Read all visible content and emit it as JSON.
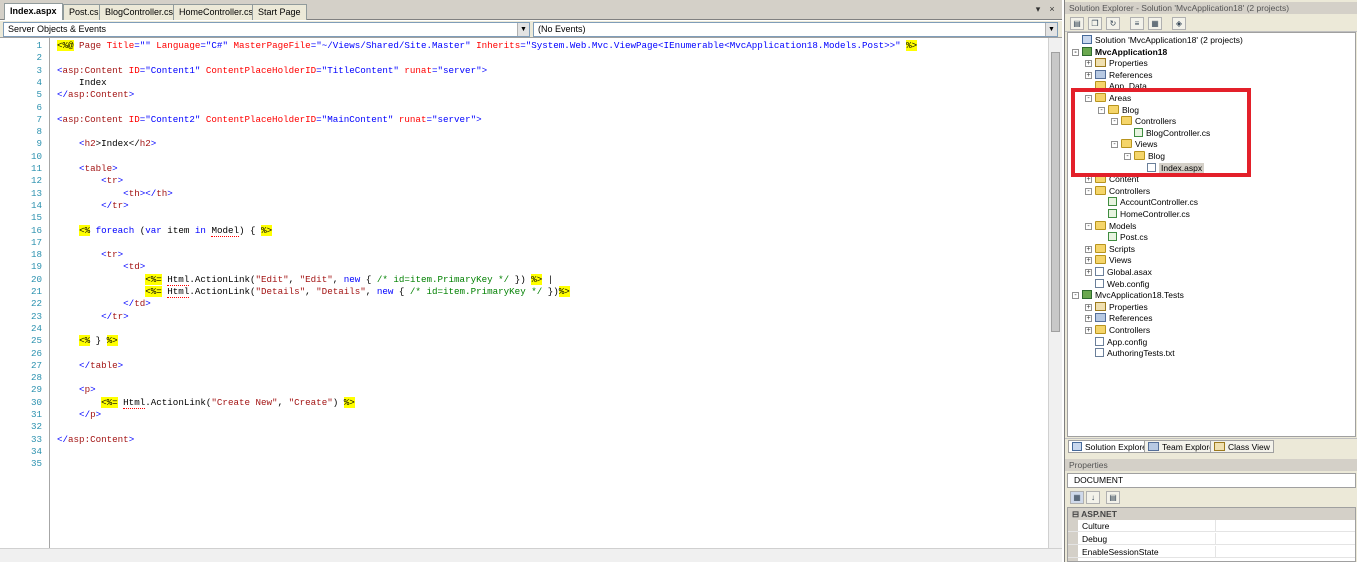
{
  "editor": {
    "tabs": [
      {
        "label": "Index.aspx",
        "active": true
      },
      {
        "label": "Post.cs",
        "active": false
      },
      {
        "label": "BlogController.cs",
        "active": false
      },
      {
        "label": "HomeController.cs",
        "active": false
      },
      {
        "label": "Start Page",
        "active": false
      }
    ],
    "window_buttons": {
      "close": "×"
    },
    "nav": {
      "objects_combo": "Server Objects & Events",
      "events_combo": "(No Events)"
    }
  },
  "code_lines": [
    {
      "n": "1"
    },
    {
      "n": "2"
    },
    {
      "n": "3"
    },
    {
      "n": "4"
    },
    {
      "n": "5"
    },
    {
      "n": "6"
    },
    {
      "n": "7"
    },
    {
      "n": "8"
    },
    {
      "n": "9"
    },
    {
      "n": "10"
    },
    {
      "n": "11"
    },
    {
      "n": "12"
    },
    {
      "n": "13"
    },
    {
      "n": "14"
    },
    {
      "n": "15"
    },
    {
      "n": "16"
    },
    {
      "n": "17"
    },
    {
      "n": "18"
    },
    {
      "n": "19"
    },
    {
      "n": "20"
    },
    {
      "n": "21"
    },
    {
      "n": "22"
    },
    {
      "n": "23"
    },
    {
      "n": "24"
    },
    {
      "n": "25"
    },
    {
      "n": "26"
    },
    {
      "n": "27"
    },
    {
      "n": "28"
    },
    {
      "n": "29"
    },
    {
      "n": "30"
    },
    {
      "n": "31"
    },
    {
      "n": "32"
    },
    {
      "n": "33"
    },
    {
      "n": "34"
    },
    {
      "n": "35"
    }
  ],
  "code_tokens": {
    "l1": [
      "<%@",
      " Page ",
      "Title",
      "=\"\" ",
      "Language",
      "=\"C#\" ",
      "MasterPageFile",
      "=\"~/Views/Shared/Site.Master\" ",
      "Inherits",
      "=\"System.Web.Mvc.ViewPage<IEnumerable<MvcApplication18.Models.Post>>\" ",
      "%>"
    ],
    "l3": [
      "<",
      "asp:Content",
      " ID",
      "=\"Content1\"",
      " ContentPlaceHolderID",
      "=\"TitleContent\"",
      " runat",
      "=\"server\"",
      ">"
    ],
    "l4": "    Index",
    "l5": [
      "</",
      "asp:Content",
      ">"
    ],
    "l7": [
      "<",
      "asp:Content",
      " ID",
      "=\"Content2\"",
      " ContentPlaceHolderID",
      "=\"MainContent\"",
      " runat",
      "=\"server\"",
      ">"
    ],
    "l9": [
      "    <",
      "h2",
      ">Index</",
      "h2",
      ">"
    ],
    "l11": [
      "    <",
      "table",
      ">"
    ],
    "l12": [
      "        <",
      "tr",
      ">"
    ],
    "l13": [
      "            <",
      "th",
      "></",
      "th",
      ">"
    ],
    "l14": [
      "        </",
      "tr",
      ">"
    ],
    "l16": [
      "    ",
      "<%",
      " ",
      "foreach",
      " (",
      "var",
      " item ",
      "in",
      " ",
      "Model",
      ") { ",
      "%>"
    ],
    "l18": [
      "        <",
      "tr",
      ">"
    ],
    "l19": [
      "            <",
      "td",
      ">"
    ],
    "l20": [
      "                ",
      "<%=",
      " ",
      "Html",
      ".ActionLink(",
      "\"Edit\"",
      ", ",
      "\"Edit\"",
      ", ",
      "new",
      " { ",
      "/* id=item.PrimaryKey */",
      " }) ",
      "%>",
      " |"
    ],
    "l21": [
      "                ",
      "<%=",
      " ",
      "Html",
      ".ActionLink(",
      "\"Details\"",
      ", ",
      "\"Details\"",
      ", ",
      "new",
      " { ",
      "/* id=item.PrimaryKey */",
      " })",
      "%>"
    ],
    "l22": [
      "            </",
      "td",
      ">"
    ],
    "l23": [
      "        </",
      "tr",
      ">"
    ],
    "l25": [
      "    ",
      "<%",
      " } ",
      "%>"
    ],
    "l27": [
      "    </",
      "table",
      ">"
    ],
    "l29": [
      "    <",
      "p",
      ">"
    ],
    "l30": [
      "        ",
      "<%=",
      " ",
      "Html",
      ".ActionLink(",
      "\"Create New\"",
      ", ",
      "\"Create\"",
      ") ",
      "%>"
    ],
    "l31": [
      "    </",
      "p",
      ">"
    ],
    "l33": [
      "</",
      "asp:Content",
      ">"
    ]
  },
  "solution_explorer": {
    "title": "Solution Explorer - Solution 'MvcApplication18' (2 projects)",
    "toolbar_icons": [
      "properties-icon",
      "show-all-files-icon",
      "refresh-icon",
      "view-code-icon",
      "view-designer-icon",
      "class-diagram-icon"
    ],
    "tree": [
      {
        "label": "Solution 'MvcApplication18' (2 projects)",
        "depth": 0,
        "icon": "solution",
        "exp": ""
      },
      {
        "label": "MvcApplication18",
        "depth": 0,
        "icon": "project",
        "exp": "-",
        "bold": true
      },
      {
        "label": "Properties",
        "depth": 1,
        "icon": "prop",
        "exp": "+"
      },
      {
        "label": "References",
        "depth": 1,
        "icon": "ref",
        "exp": "+"
      },
      {
        "label": "App_Data",
        "depth": 1,
        "icon": "folder",
        "exp": ""
      },
      {
        "label": "Areas",
        "depth": 1,
        "icon": "folder",
        "exp": "-"
      },
      {
        "label": "Blog",
        "depth": 2,
        "icon": "folder",
        "exp": "-"
      },
      {
        "label": "Controllers",
        "depth": 3,
        "icon": "folder",
        "exp": "-"
      },
      {
        "label": "BlogController.cs",
        "depth": 4,
        "icon": "cs",
        "exp": ""
      },
      {
        "label": "Views",
        "depth": 3,
        "icon": "folder",
        "exp": "-"
      },
      {
        "label": "Blog",
        "depth": 4,
        "icon": "folder",
        "exp": "-"
      },
      {
        "label": "Index.aspx",
        "depth": 5,
        "icon": "file",
        "exp": "",
        "selected": true
      },
      {
        "label": "Content",
        "depth": 1,
        "icon": "folder",
        "exp": "+"
      },
      {
        "label": "Controllers",
        "depth": 1,
        "icon": "folder",
        "exp": "-"
      },
      {
        "label": "AccountController.cs",
        "depth": 2,
        "icon": "cs",
        "exp": ""
      },
      {
        "label": "HomeController.cs",
        "depth": 2,
        "icon": "cs",
        "exp": ""
      },
      {
        "label": "Models",
        "depth": 1,
        "icon": "folder",
        "exp": "-"
      },
      {
        "label": "Post.cs",
        "depth": 2,
        "icon": "cs",
        "exp": ""
      },
      {
        "label": "Scripts",
        "depth": 1,
        "icon": "folder",
        "exp": "+"
      },
      {
        "label": "Views",
        "depth": 1,
        "icon": "folder",
        "exp": "+"
      },
      {
        "label": "Global.asax",
        "depth": 1,
        "icon": "file",
        "exp": "+"
      },
      {
        "label": "Web.config",
        "depth": 1,
        "icon": "file",
        "exp": ""
      },
      {
        "label": "MvcApplication18.Tests",
        "depth": 0,
        "icon": "project",
        "exp": "-"
      },
      {
        "label": "Properties",
        "depth": 1,
        "icon": "prop",
        "exp": "+"
      },
      {
        "label": "References",
        "depth": 1,
        "icon": "ref",
        "exp": "+"
      },
      {
        "label": "Controllers",
        "depth": 1,
        "icon": "folder",
        "exp": "+"
      },
      {
        "label": "App.config",
        "depth": 1,
        "icon": "file",
        "exp": ""
      },
      {
        "label": "AuthoringTests.txt",
        "depth": 1,
        "icon": "file",
        "exp": ""
      }
    ],
    "bottom_tabs": [
      {
        "label": "Solution Explorer",
        "active": true
      },
      {
        "label": "Team Explorer",
        "active": false
      },
      {
        "label": "Class View",
        "active": false
      }
    ],
    "highlight_color": "#e3202a"
  },
  "properties": {
    "title": "Properties",
    "object": "DOCUMENT",
    "category": "ASP.NET",
    "rows": [
      "Culture",
      "Debug",
      "EnableSessionState"
    ]
  }
}
